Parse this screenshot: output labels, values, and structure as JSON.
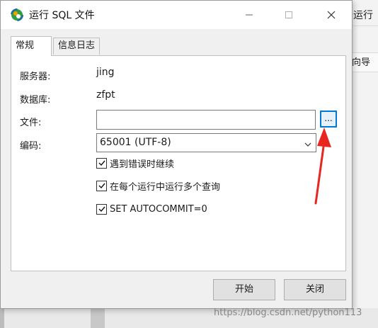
{
  "window": {
    "title": "运行 SQL 文件",
    "minimize_symbol": "—",
    "maximize_symbol": "☐",
    "close_symbol": "✕"
  },
  "tabs": [
    {
      "label": "常规",
      "active": true
    },
    {
      "label": "信息日志",
      "active": false
    }
  ],
  "form": {
    "server_label": "服务器:",
    "server_value": "jing",
    "database_label": "数据库:",
    "database_value": "zfpt",
    "file_label": "文件:",
    "file_value": "",
    "browse_label": "...",
    "encoding_label": "编码:",
    "encoding_value": "65001 (UTF-8)"
  },
  "options": [
    {
      "label": "遇到错误时继续",
      "checked": true
    },
    {
      "label": "在每个运行中运行多个查询",
      "checked": true
    },
    {
      "label": "SET AUTOCOMMIT=0",
      "checked": true
    }
  ],
  "buttons": {
    "start": "开始",
    "close": "关闭"
  },
  "background": {
    "run_tab": "运行",
    "wizard_tab": "向导"
  },
  "annotation": {
    "arrow_color": "#e8251f"
  },
  "watermark": "https://blog.csdn.net/python113",
  "colors": {
    "focus_border": "#0078d7",
    "titlebar": "#ffffff",
    "dialog": "#f0f0f0"
  }
}
